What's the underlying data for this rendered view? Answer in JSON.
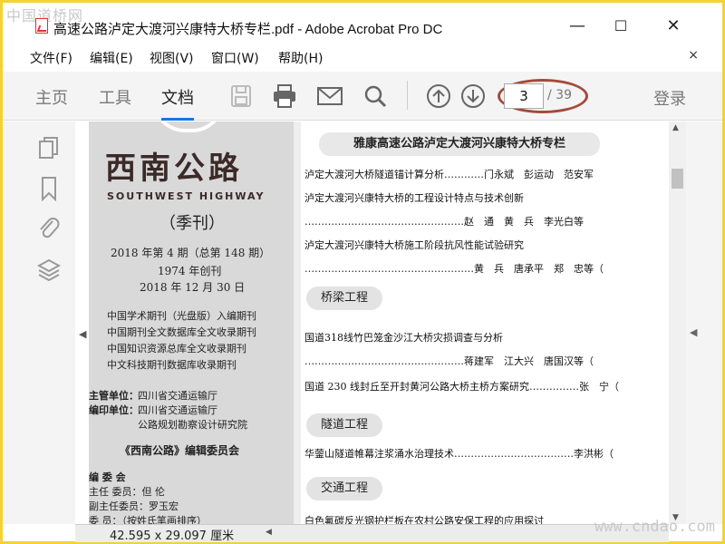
{
  "watermark": {
    "top": "中国道桥网",
    "bottom": "www.cndao.com"
  },
  "window": {
    "title": "高速公路泸定大渡河兴康特大桥专栏.pdf - Adobe Acrobat Pro DC",
    "icon": "pdf-file-icon",
    "minimize": "—",
    "maximize": "☐",
    "close": "✕"
  },
  "menubar": {
    "items": [
      "文件(F)",
      "编辑(E)",
      "视图(V)",
      "窗口(W)",
      "帮助(H)"
    ],
    "close": "×"
  },
  "toolbar": {
    "tabs": [
      "主页",
      "工具",
      "文档"
    ],
    "active_tab": "文档",
    "icons": [
      "save-icon",
      "print-icon",
      "email-icon",
      "search-icon",
      "page-up-icon",
      "page-down-icon"
    ],
    "page_current": "3",
    "page_total": "/ 39",
    "login": "登录",
    "highlight_color": "#a44a3a"
  },
  "left_panel": {
    "icons": [
      "page-thumbnails-icon",
      "bookmarks-icon",
      "attachments-icon",
      "layers-icon"
    ]
  },
  "cover": {
    "title": "西南公路",
    "subtitle_en": "SOUTHWEST HIGHWAY",
    "quarterly": "（季刊）",
    "issue": "2018 年第 4 期（总第 148 期）",
    "founded": "1974 年创刊",
    "date": "2018 年 12 月 30 日",
    "indexes": [
      "中国学术期刊（光盘版）入编期刊",
      "中国期刊全文数据库全文收录期刊",
      "中国知识资源总库全文收录期刊",
      "中文科技期刊数据库收录期刊"
    ],
    "sponsor_label": "主管单位：",
    "sponsor": "四川省交通运输厅",
    "editor_label": "编印单位：",
    "editor_1": "四川省交通运输厅",
    "editor_2": "公路规划勘察设计研究院",
    "board_title": "《西南公路》编辑委员会",
    "board_head": "编  委  会",
    "chair": "主任  委员：但  伦",
    "vice_chair": "副主任委员：罗玉宏",
    "members_partial": "委      员：（按姓氏笔画排序）"
  },
  "toc": {
    "header": "雅康高速公路泸定大渡河兴康特大桥专栏",
    "entries": [
      "泸定大渡河大桥隧道锚计算分析…………门永斌　彭运动　范安军",
      "泸定大渡河兴康特大桥的工程设计特点与技术创新",
      "…………………………………………赵　通　黄　兵　李光白等",
      "泸定大渡河兴康特大桥施工阶段抗风性能试验研究",
      "……………………………………………黄　兵　唐承平　郑　忠等（",
      "国道318线竹巴笼金沙江大桥灾损调查与分析",
      "…………………………………………蒋建军　江大兴　唐国汉等（",
      "国道 230 线封丘至开封黄河公路大桥主桥方案研究……………张　宁（",
      "华蓥山隧道帷幕注浆涌水治理技术………………………………李洪彬（",
      "白色氟碳反光钢护栏板在农村公路安保工程的应用探讨"
    ],
    "sections": [
      "桥梁工程",
      "隧道工程",
      "交通工程"
    ]
  },
  "statusbar": {
    "page_size": "42.595 x 29.097 厘米"
  }
}
